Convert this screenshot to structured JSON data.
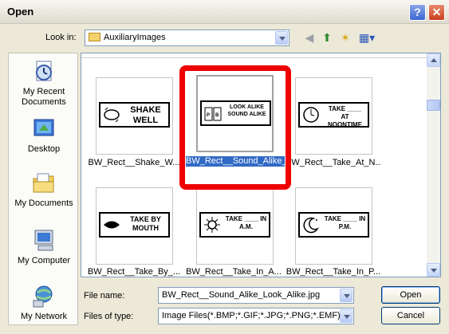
{
  "window": {
    "title": "Open",
    "help": "?",
    "close": "✕"
  },
  "look_in": {
    "label": "Look in:",
    "value": "AuxiliaryImages"
  },
  "toolbar": {
    "back": "◀",
    "up": "⬆",
    "new_folder": "✶",
    "views": "▦▾"
  },
  "places": [
    {
      "label": "My Recent Documents"
    },
    {
      "label": "Desktop"
    },
    {
      "label": "My Documents"
    },
    {
      "label": "My Computer"
    },
    {
      "label": "My Network"
    }
  ],
  "files": [
    {
      "caption": "BW_Rect__Shake_W...",
      "img_text": "SHAKE WELL"
    },
    {
      "caption": "BW_Rect__Sound_Alike_Look_Alike.jpg",
      "img_text": "LOOK ALIKE SOUND ALIKE"
    },
    {
      "caption": "BW_Rect__Take_At_N...",
      "img_text": "TAKE ____ AT NOONTIME"
    },
    {
      "caption": "BW_Rect__Take_By_...",
      "img_text": "TAKE BY MOUTH"
    },
    {
      "caption": "BW_Rect__Take_In_A...",
      "img_text": "TAKE ____ IN A.M."
    },
    {
      "caption": "BW_Rect__Take_In_P...",
      "img_text": "TAKE ____ IN P.M."
    }
  ],
  "file_name": {
    "label": "File name:",
    "value": "BW_Rect__Sound_Alike_Look_Alike.jpg"
  },
  "file_type": {
    "label": "Files of type:",
    "value": "Image Files(*.BMP;*.GIF;*.JPG;*.PNG;*.EMF)"
  },
  "buttons": {
    "open": "Open",
    "cancel": "Cancel"
  }
}
